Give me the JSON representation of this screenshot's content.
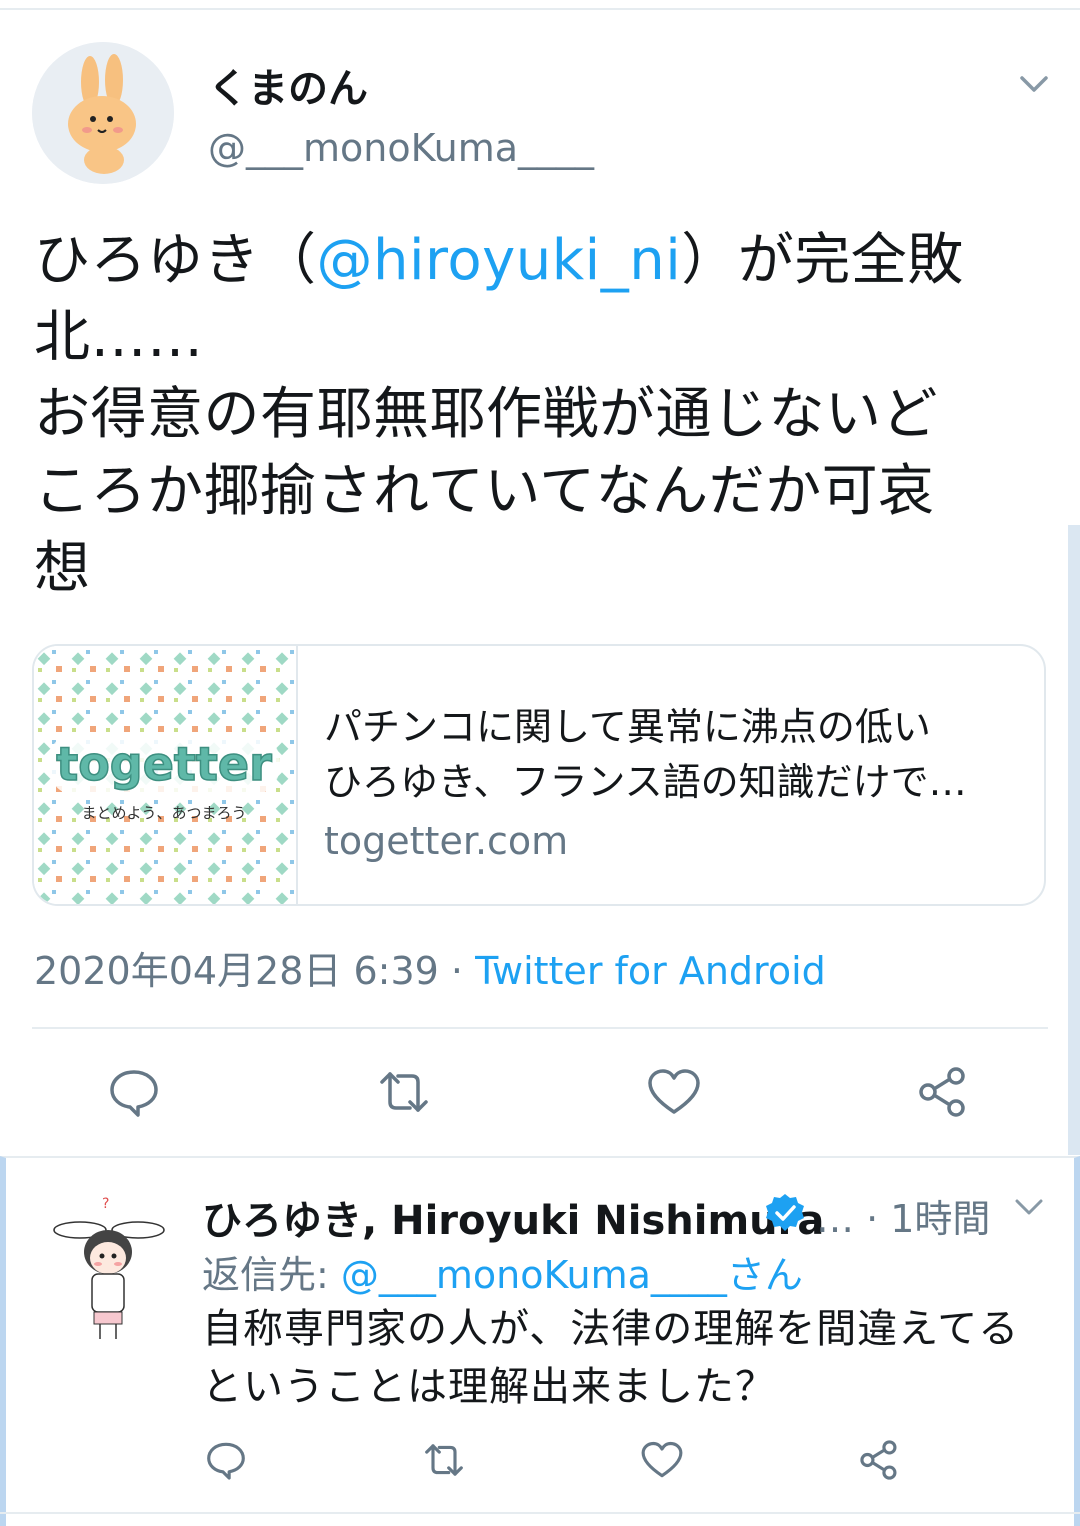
{
  "tweet": {
    "author_name": "くまのん",
    "author_handle": "@___monoKuma____",
    "text_before": "ひろゆき（",
    "mention": "@hiroyuki_ni",
    "text_after": "）が完全敗\n北……\nお得意の有耶無耶作戦が通じないど\nころか揶揄されていてなんだか可哀\n想",
    "card": {
      "thumb_logo": "togetter",
      "thumb_tagline": "まとめよう、あつまろう",
      "title_line1": "パチンコに関して異常に沸点の低い",
      "title_line2": "ひろゆき、フランス語の知識だけで…",
      "domain": "togetter.com"
    },
    "timestamp": "2020年04月28日 6:39 · ",
    "source": "Twitter for Android",
    "actions": [
      "reply-icon",
      "retweet-icon",
      "like-icon",
      "share-icon"
    ]
  },
  "reply": {
    "author_name": "ひろゆき, Hiroyuki Nishimura",
    "time": "… · 1時間",
    "reply_to_label": "返信先: ",
    "reply_to_handle": "@___monoKuma____さん",
    "text": "自称専門家の人が、法律の理解を間違えてる\nということは理解出来ました？"
  },
  "colors": {
    "accent": "#1da1f2",
    "secondary_text": "#657786",
    "togetter_teal": "#5fb8a8"
  }
}
